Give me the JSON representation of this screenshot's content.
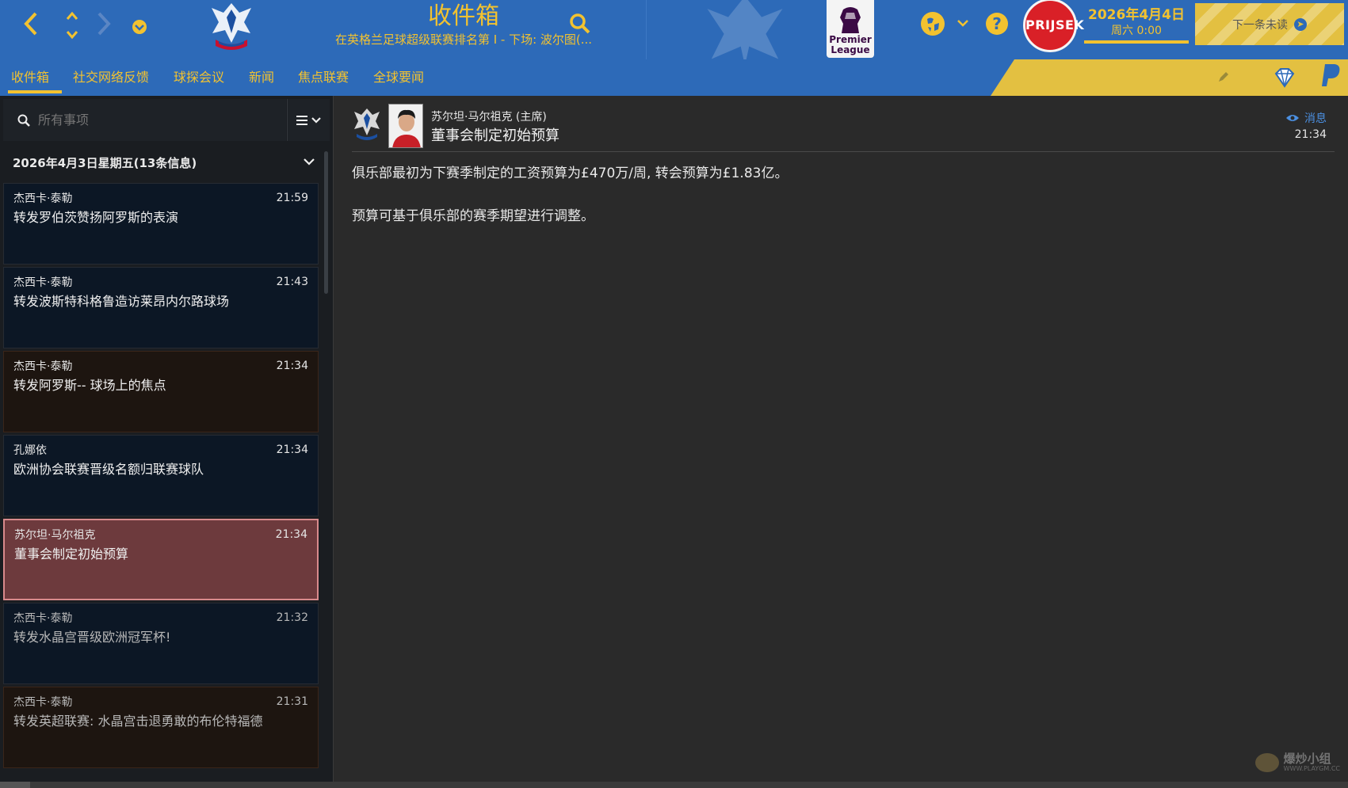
{
  "header": {
    "title": "收件箱",
    "subtitle": "在英格兰足球超级联赛排名第 I - 下场: 波尔图(...",
    "league_logo_text": [
      "Premier",
      "League"
    ],
    "avatar_text": "PRIJSEK",
    "date": "2026年4月4日",
    "day_time": "周六 0:00",
    "next_unread_label": "下一条未读",
    "help_label": "?"
  },
  "tabs": [
    {
      "label": "收件箱",
      "active": true
    },
    {
      "label": "社交网络反馈"
    },
    {
      "label": "球探会议"
    },
    {
      "label": "新闻"
    },
    {
      "label": "焦点联赛"
    },
    {
      "label": "全球要闻"
    }
  ],
  "sidebar": {
    "search_placeholder": "所有事项",
    "group_header": "2026年4月3日星期五(13条信息)",
    "messages": [
      {
        "sender": "杰西卡·泰勒",
        "time": "21:59",
        "subject": "转发罗伯茨赞扬阿罗斯的表演",
        "style": "navy"
      },
      {
        "sender": "杰西卡·泰勒",
        "time": "21:43",
        "subject": "转发波斯特科格鲁造访莱昂内尔路球场",
        "style": "navy"
      },
      {
        "sender": "杰西卡·泰勒",
        "time": "21:34",
        "subject": "转发阿罗斯-- 球场上的焦点",
        "style": "brown"
      },
      {
        "sender": "孔娜依",
        "time": "21:34",
        "subject": "欧洲协会联赛晋级名额归联赛球队",
        "style": "navy"
      },
      {
        "sender": "苏尔坦·马尔祖克",
        "time": "21:34",
        "subject": "董事会制定初始预算",
        "style": "selected"
      },
      {
        "sender": "杰西卡·泰勒",
        "time": "21:32",
        "subject": "转发水晶宫晋级欧洲冠军杯!",
        "style": "navy read"
      },
      {
        "sender": "杰西卡·泰勒",
        "time": "21:31",
        "subject": "转发英超联赛: 水晶宫击退勇敢的布伦特福德",
        "style": "brown read"
      }
    ]
  },
  "message": {
    "sender": "苏尔坦·马尔祖克 (主席)",
    "subject": "董事会制定初始预算",
    "type_label": "消息",
    "time": "21:34",
    "body": [
      "俱乐部最初为下赛季制定的工资预算为£470万/周, 转会预算为£1.83亿。",
      "预算可基于俱乐部的赛季期望进行调整。"
    ]
  },
  "watermark": {
    "text": "爆炒小组",
    "url": "WWW.PLAYGM.CC"
  },
  "colors": {
    "accent": "#f2c230",
    "header_blue": "#2d6ab8",
    "selected": "#6d3a3d",
    "type_blue": "#4b8fe0"
  }
}
